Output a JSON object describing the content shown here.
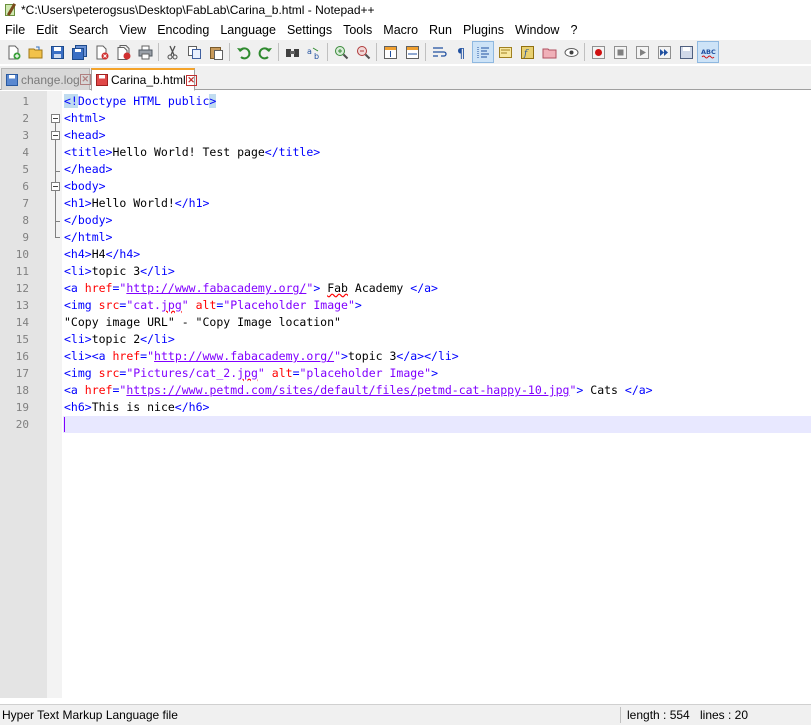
{
  "window": {
    "title": "*C:\\Users\\peterogsus\\Desktop\\FabLab\\Carina_b.html - Notepad++"
  },
  "menu": [
    "File",
    "Edit",
    "Search",
    "View",
    "Encoding",
    "Language",
    "Settings",
    "Tools",
    "Macro",
    "Run",
    "Plugins",
    "Window",
    "?"
  ],
  "toolbar_icons": [
    "new-file-icon",
    "open-file-icon",
    "save-icon",
    "save-all-icon",
    "close-icon",
    "close-all-icon",
    "print-icon",
    "cut-icon",
    "copy-icon",
    "paste-icon",
    "undo-icon",
    "redo-icon",
    "find-icon",
    "replace-icon",
    "zoom-in-icon",
    "zoom-out-icon",
    "sync-vertical-icon",
    "sync-horizontal-icon",
    "word-wrap-icon",
    "show-all-chars-icon",
    "indent-guide-icon",
    "doc-map-icon",
    "function-list-icon",
    "folder-workspace-icon",
    "monitoring-icon",
    "record-macro-icon",
    "stop-record-icon",
    "play-macro-icon",
    "run-macro-multiple-icon",
    "save-macro-icon",
    "spell-check-icon"
  ],
  "spellcheck_label": "ABC",
  "tabs": [
    {
      "label": "change.log",
      "active": false
    },
    {
      "label": "Carina_b.html",
      "active": true
    }
  ],
  "editor": {
    "lines": [
      {
        "n": "1",
        "segs": [
          [
            "hl",
            "<!"
          ],
          [
            "tag",
            "Doctype HTML public"
          ],
          [
            "hl",
            ">"
          ]
        ]
      },
      {
        "n": "2",
        "segs": [
          [
            "tag",
            "<html>"
          ]
        ]
      },
      {
        "n": "3",
        "segs": [
          [
            "tag",
            "<head>"
          ]
        ]
      },
      {
        "n": "4",
        "segs": [
          [
            "tag",
            "<title>"
          ],
          [
            "txt",
            "Hello World! Test page"
          ],
          [
            "tag",
            "</title>"
          ]
        ]
      },
      {
        "n": "5",
        "segs": [
          [
            "tag",
            "</head>"
          ]
        ]
      },
      {
        "n": "6",
        "segs": [
          [
            "tag",
            "<body>"
          ]
        ]
      },
      {
        "n": "7",
        "segs": [
          [
            "tag",
            "<h1>"
          ],
          [
            "txt",
            "Hello World!"
          ],
          [
            "tag",
            "</h1>"
          ]
        ]
      },
      {
        "n": "8",
        "segs": [
          [
            "tag",
            "</body>"
          ]
        ]
      },
      {
        "n": "9",
        "segs": [
          [
            "tag",
            "</html>"
          ]
        ]
      },
      {
        "n": "10",
        "segs": [
          [
            "tag",
            "<h4>"
          ],
          [
            "txt",
            "H4"
          ],
          [
            "tag",
            "</h4>"
          ]
        ]
      },
      {
        "n": "11",
        "segs": [
          [
            "tag",
            "<li>"
          ],
          [
            "txt",
            "topic 3"
          ],
          [
            "tag",
            "</li>"
          ]
        ]
      },
      {
        "n": "12",
        "segs": [
          [
            "tag",
            "<a "
          ],
          [
            "attr",
            "href"
          ],
          [
            "tag",
            "="
          ],
          [
            "val",
            "\""
          ],
          [
            "url",
            "http://www.fabacademy.org/"
          ],
          [
            "val",
            "\""
          ],
          [
            "tag",
            ">"
          ],
          [
            "txt",
            " "
          ],
          [
            "squig",
            "Fab"
          ],
          [
            "txt",
            " Academy "
          ],
          [
            "tag",
            "</a>"
          ]
        ]
      },
      {
        "n": "13",
        "segs": [
          [
            "tag",
            "<img "
          ],
          [
            "attr",
            "src"
          ],
          [
            "tag",
            "="
          ],
          [
            "val",
            "\"cat."
          ],
          [
            "valsquig",
            "jpg"
          ],
          [
            "val",
            "\""
          ],
          [
            "txt",
            " "
          ],
          [
            "attr",
            "alt"
          ],
          [
            "tag",
            "="
          ],
          [
            "val",
            "\"Placeholder Image\""
          ],
          [
            "tag",
            ">"
          ]
        ]
      },
      {
        "n": "14",
        "segs": [
          [
            "txt",
            "\"Copy image URL\" - \"Copy Image location\""
          ]
        ]
      },
      {
        "n": "15",
        "segs": [
          [
            "tag",
            "<li>"
          ],
          [
            "txt",
            "topic 2"
          ],
          [
            "tag",
            "</li>"
          ]
        ]
      },
      {
        "n": "16",
        "segs": [
          [
            "tag",
            "<li><a "
          ],
          [
            "attr",
            "href"
          ],
          [
            "tag",
            "="
          ],
          [
            "val",
            "\""
          ],
          [
            "url",
            "http://www.fabacademy.org/"
          ],
          [
            "val",
            "\""
          ],
          [
            "tag",
            ">"
          ],
          [
            "txt",
            "topic 3"
          ],
          [
            "tag",
            "</a></li>"
          ]
        ]
      },
      {
        "n": "17",
        "segs": [
          [
            "tag",
            "<img "
          ],
          [
            "attr",
            "src"
          ],
          [
            "tag",
            "="
          ],
          [
            "val",
            "\"Pictures/cat_2."
          ],
          [
            "valsquig",
            "jpg"
          ],
          [
            "val",
            "\""
          ],
          [
            "txt",
            " "
          ],
          [
            "attr",
            "alt"
          ],
          [
            "tag",
            "="
          ],
          [
            "val",
            "\"placeholder Image\""
          ],
          [
            "tag",
            ">"
          ]
        ]
      },
      {
        "n": "18",
        "segs": [
          [
            "tag",
            "<a "
          ],
          [
            "attr",
            "href"
          ],
          [
            "tag",
            "="
          ],
          [
            "val",
            "\""
          ],
          [
            "url",
            "https://www.petmd.com/sites/default/files/petmd-cat-happy-10.jpg"
          ],
          [
            "val",
            "\""
          ],
          [
            "tag",
            ">"
          ],
          [
            "txt",
            " Cats "
          ],
          [
            "tag",
            "</a>"
          ]
        ]
      },
      {
        "n": "19",
        "segs": [
          [
            "tag",
            "<h6>"
          ],
          [
            "txt",
            "This is nice"
          ],
          [
            "tag",
            "</h6>"
          ]
        ]
      },
      {
        "n": "20",
        "segs": [],
        "current": true
      }
    ]
  },
  "statusbar": {
    "file_type": "Hyper Text Markup Language file",
    "length": "length : 554",
    "lines": "lines : 20"
  },
  "colors": {
    "tag": "#0000ff",
    "attribute": "#ff0000",
    "value": "#8000ff",
    "current_line": "#e8e8ff",
    "active_tab_accent": "#f4a32a"
  }
}
